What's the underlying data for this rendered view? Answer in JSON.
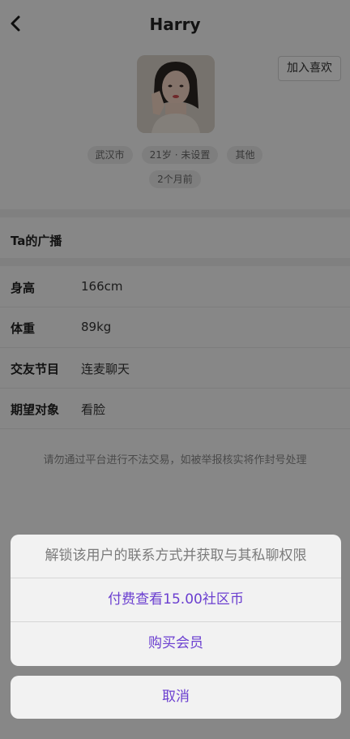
{
  "header": {
    "title": "Harry",
    "back_icon": "back-chevron-icon"
  },
  "profile": {
    "like_button": "加入喜欢",
    "tags": [
      "武汉市",
      "21岁 · 未设置",
      "其他"
    ],
    "last_active": "2个月前"
  },
  "broadcast": {
    "title": "Ta的广播"
  },
  "info": [
    {
      "label": "身高",
      "value": "166cm"
    },
    {
      "label": "体重",
      "value": "89kg"
    },
    {
      "label": "交友节目",
      "value": "连麦聊天"
    },
    {
      "label": "期望对象",
      "value": "看脸"
    }
  ],
  "notice": "请勿通过平台进行不法交易，如被举报核实将作封号处理",
  "action_sheet": {
    "header": "解锁该用户的联系方式并获取与其私聊权限",
    "options": [
      "付费查看15.00社区币",
      "购买会员"
    ],
    "cancel": "取消"
  },
  "colors": {
    "accent": "#6b3fd0",
    "overlay": "rgba(0,0,0,0.45)"
  }
}
